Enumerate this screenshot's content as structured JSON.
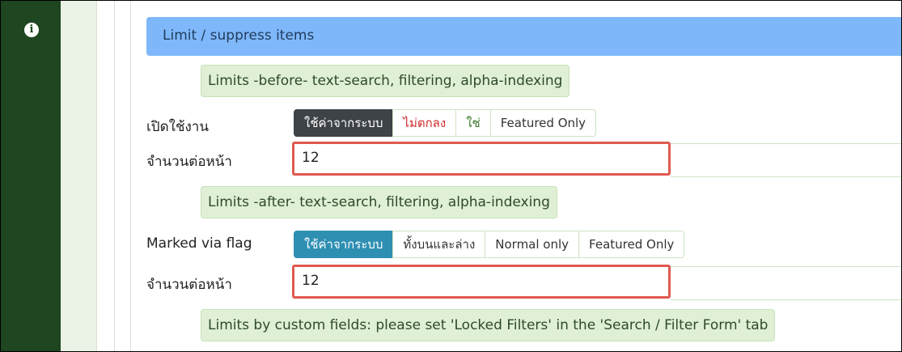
{
  "sidebar": {
    "icon": "info-icon"
  },
  "section": {
    "title": "Limit / suppress items"
  },
  "notes": {
    "before": "Limits -before- text-search, filtering, alpha-indexing",
    "after": "Limits -after- text-search, filtering, alpha-indexing",
    "custom": "Limits by custom fields: please set 'Locked Filters' in the 'Search / Filter Form' tab"
  },
  "before_group": {
    "enable_label": "เปิดใช้งาน",
    "options": [
      "ใช้ค่าจากระบบ",
      "ไม่ตกลง",
      "ใช่",
      "Featured Only"
    ],
    "selected": "ใช้ค่าจากระบบ",
    "per_page_label": "จำนวนต่อหน้า",
    "per_page_value": "12"
  },
  "after_group": {
    "marked_label": "Marked via flag",
    "options": [
      "ใช้ค่าจากระบบ",
      "ทั้งบนและล่าง",
      "Normal only",
      "Featured Only"
    ],
    "selected": "ใช้ค่าจากระบบ",
    "per_page_label": "จำนวนต่อหน้า",
    "per_page_value": "12"
  },
  "colors": {
    "sidebar": "#1e4620",
    "header": "#7fb8fa",
    "note_bg": "#dff0d6",
    "highlight_border": "#e05a4f",
    "selected_dark": "#3e4347",
    "selected_teal": "#2e8fb3"
  }
}
